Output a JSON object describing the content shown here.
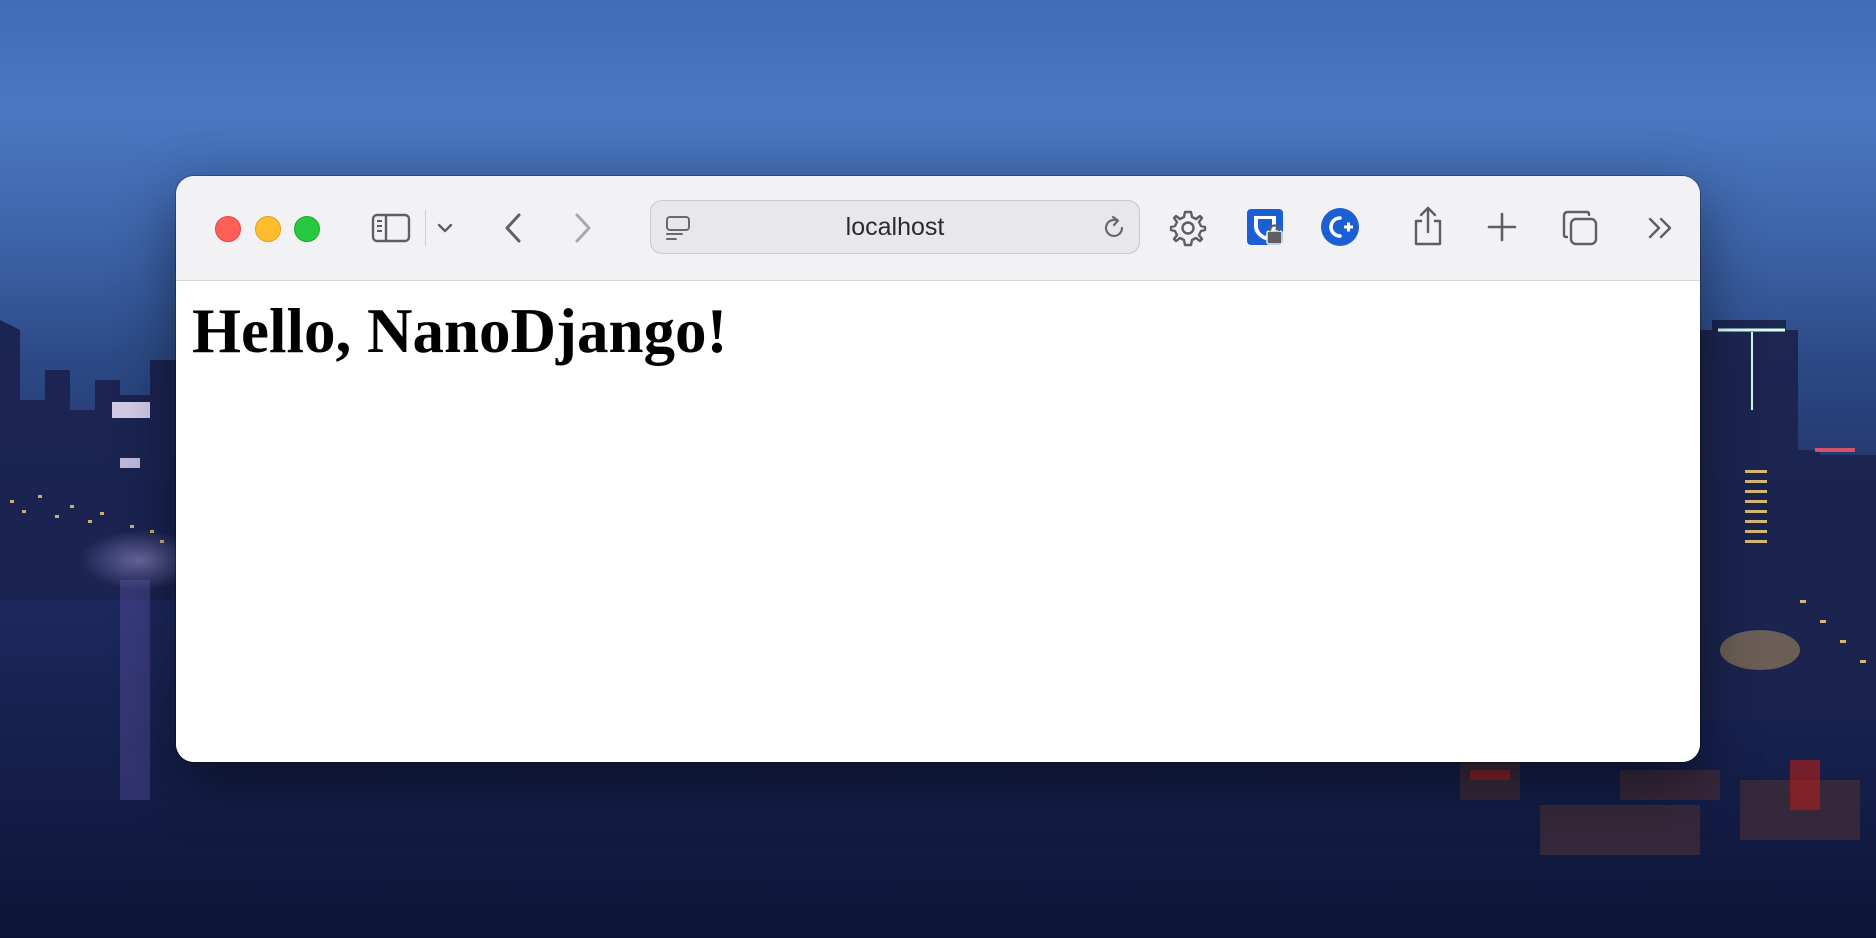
{
  "browser": {
    "address_bar": {
      "url_text": "localhost"
    },
    "toolbar": {
      "icons": [
        "close-button",
        "minimize-button",
        "maximize-button",
        "sidebar-icon",
        "chevron-down-icon",
        "back-icon",
        "forward-icon",
        "page-menu-icon",
        "reload-icon",
        "gear-icon",
        "password-manager-extension-icon",
        "c-plus-extension-icon",
        "share-icon",
        "new-tab-icon",
        "tab-overview-icon",
        "more-toolbar-items-icon"
      ]
    }
  },
  "page": {
    "heading": "Hello, NanoDjango!"
  },
  "colors": {
    "close": "#fe5f57",
    "minimize": "#febc2e",
    "maximize": "#28c840",
    "extension_blue": "#1a5fd4",
    "toolbar_bg": "#f2f2f4"
  }
}
